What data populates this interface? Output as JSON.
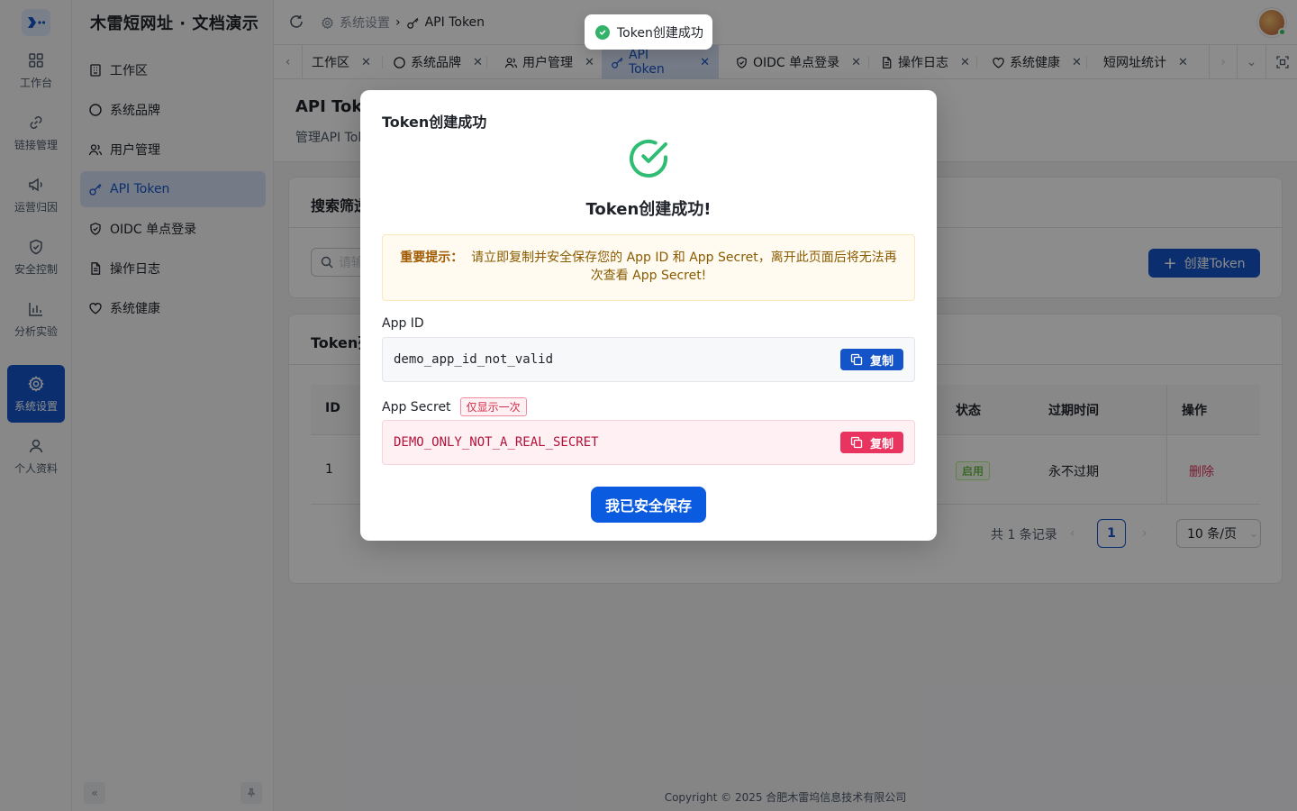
{
  "rail": {
    "items": [
      {
        "label": "工作台",
        "icon": "dashboard-icon"
      },
      {
        "label": "链接管理",
        "icon": "link-icon"
      },
      {
        "label": "运营归因",
        "icon": "megaphone-icon"
      },
      {
        "label": "安全控制",
        "icon": "shield-icon"
      },
      {
        "label": "分析实验",
        "icon": "bar-chart-icon"
      },
      {
        "label": "系统设置",
        "icon": "gear-icon"
      },
      {
        "label": "个人资料",
        "icon": "user-icon"
      }
    ],
    "active": "系统设置"
  },
  "sidebar": {
    "title": "木雷短网址 · 文档演示",
    "items": [
      {
        "label": "工作区",
        "icon": "building-icon"
      },
      {
        "label": "系统品牌",
        "icon": "circle-icon"
      },
      {
        "label": "用户管理",
        "icon": "users-icon"
      },
      {
        "label": "API Token",
        "icon": "key-icon"
      },
      {
        "label": "OIDC 单点登录",
        "icon": "shield-check-icon"
      },
      {
        "label": "操作日志",
        "icon": "file-icon"
      },
      {
        "label": "系统健康",
        "icon": "heart-icon"
      }
    ],
    "active": "API Token"
  },
  "header": {
    "breadcrumb": [
      "系统设置",
      "API Token"
    ]
  },
  "tabs": [
    {
      "label": "工作区"
    },
    {
      "label": "系统品牌"
    },
    {
      "label": "用户管理"
    },
    {
      "label": "API Token",
      "active": true
    },
    {
      "label": "OIDC 单点登录"
    },
    {
      "label": "操作日志"
    },
    {
      "label": "系统健康"
    },
    {
      "label": "短网址统计"
    }
  ],
  "page": {
    "title": "API Toke",
    "desc": "管理API Tol"
  },
  "filter": {
    "title": "搜索筛逆",
    "search_placeholder": "请输",
    "create_label": "创建Token"
  },
  "table": {
    "title": "Token列",
    "headers": {
      "id": "ID",
      "status": "状态",
      "expire": "过期时间",
      "action": "操作"
    },
    "rows": [
      {
        "id": "1",
        "status": "启用",
        "expire": "永不过期",
        "action": "删除"
      }
    ],
    "pager": {
      "total": "共 1 条记录",
      "page": "1",
      "size": "10 条/页"
    }
  },
  "footer": {
    "copyright": "Copyright © 2025 合肥木雷坞信息技术有限公司"
  },
  "toast": {
    "message": "Token创建成功"
  },
  "modal": {
    "title": "Token创建成功",
    "heading": "Token创建成功!",
    "warning_label": "重要提示：",
    "warning_text": "请立即复制并安全保存您的 App ID 和 App Secret，离开此页面后将无法再次查看 App Secret!",
    "app_id_label": "App ID",
    "app_id_value": "demo_app_id_not_valid",
    "app_secret_label": "App Secret",
    "app_secret_tag": "仅显示一次",
    "app_secret_value": "DEMO_ONLY_NOT_A_REAL_SECRET",
    "copy_label": "复制",
    "confirm_label": "我已安全保存"
  },
  "colors": {
    "primary": "#1554c8",
    "danger": "#e8345f",
    "success": "#34b26a",
    "warning_bg": "#fffbf0"
  }
}
